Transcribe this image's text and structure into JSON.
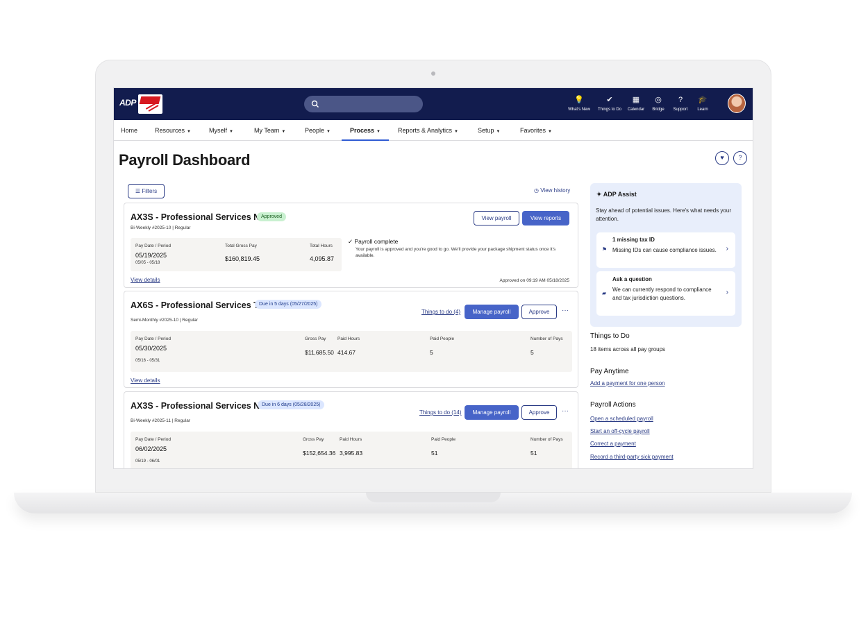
{
  "header": {
    "adp_logo": "ADP",
    "nav_icons": [
      {
        "icon": "lightbulb-icon",
        "label": "What's New"
      },
      {
        "icon": "check-badge-icon",
        "label": "Things to Do"
      },
      {
        "icon": "calendar-icon",
        "label": "Calendar"
      },
      {
        "icon": "bridge-icon",
        "label": "Bridge"
      },
      {
        "icon": "help-icon",
        "label": "Support"
      },
      {
        "icon": "graduation-cap-icon",
        "label": "Learn"
      }
    ]
  },
  "menu": {
    "items": [
      "Home",
      "Resources",
      "Myself",
      "My Team",
      "People",
      "Process",
      "Reports & Analytics",
      "Setup",
      "Favorites"
    ],
    "active": "Process"
  },
  "page": {
    "title": "Payroll Dashboard",
    "filters_label": "Filters",
    "view_history": "View history"
  },
  "cards": [
    {
      "title": "AX3S - Professional Services N...",
      "badge": "Approved",
      "subtitle": "Bi-Weekly #2025-10 | Regular",
      "btn1": "View payroll",
      "btn2": "View reports",
      "pay_label": "Pay Date / Period",
      "pay_date": "05/19/2025",
      "period": "05/05 - 05/18",
      "gross_label": "Total Gross Pay",
      "gross": "$160,819.45",
      "hours_label": "Total Hours",
      "hours": "4,095.87",
      "complete_title": "Payroll complete",
      "complete_desc": "Your payroll is approved and you're good to go. We'll provide your package shipment status once it's available.",
      "view_details": "View details",
      "approved_on": "Approved on 09:19 AM 05/18/2025"
    },
    {
      "title": "AX6S - Professional Services T...",
      "badge": "Due in 5 days (05/27/2025)",
      "subtitle": "Semi-Monthly #2025-10 | Regular",
      "things_link": "Things to do (4)",
      "btn1": "Manage payroll",
      "btn2": "Approve",
      "more": "···",
      "pay_label": "Pay Date / Period",
      "pay_date": "05/30/2025",
      "period": "05/16 - 05/31",
      "gross_label": "Gross Pay",
      "gross": "$11,685.50",
      "hours_label": "Paid Hours",
      "hours": "414.67",
      "people_label": "Paid People",
      "people": "5",
      "pays_label": "Number of Pays",
      "pays": "5",
      "view_details": "View details"
    },
    {
      "title": "AX3S - Professional Services N...",
      "badge": "Due in 6 days (05/28/2025)",
      "subtitle": "Bi-Weekly #2025-11 | Regular",
      "things_link": "Things to do (14)",
      "btn1": "Manage payroll",
      "btn2": "Approve",
      "more": "···",
      "pay_label": "Pay Date / Period",
      "pay_date": "06/02/2025",
      "period": "05/19 - 06/01",
      "gross_label": "Gross Pay",
      "gross": "$152,654.36",
      "hours_label": "Paid Hours",
      "hours": "3,995.83",
      "people_label": "Paid People",
      "people": "51",
      "pays_label": "Number of Pays",
      "pays": "51"
    }
  ],
  "assist": {
    "title": "ADP Assist",
    "desc": "Stay ahead of potential issues. Here's what needs your attention.",
    "items": [
      {
        "title": "1 missing tax ID",
        "desc": "Missing IDs can cause compliance issues."
      },
      {
        "title": "Ask a question",
        "desc": "We can currently respond to compliance and tax jurisdiction questions."
      }
    ]
  },
  "side": {
    "things_title": "Things to Do",
    "things_desc": "18 items across all pay groups",
    "pay_anytime_title": "Pay Anytime",
    "pay_anytime_link": "Add a payment for one person",
    "actions_title": "Payroll Actions",
    "actions": [
      "Open a scheduled payroll",
      "Start an off-cycle payroll",
      "Correct a payment",
      "Record a third-party sick payment"
    ]
  },
  "colors": {
    "header_bg": "#121c4e",
    "primary": "#4764c8",
    "link": "#2a3b85",
    "approved_badge": "#c9f0d0",
    "due_badge": "#dbe6ff"
  }
}
